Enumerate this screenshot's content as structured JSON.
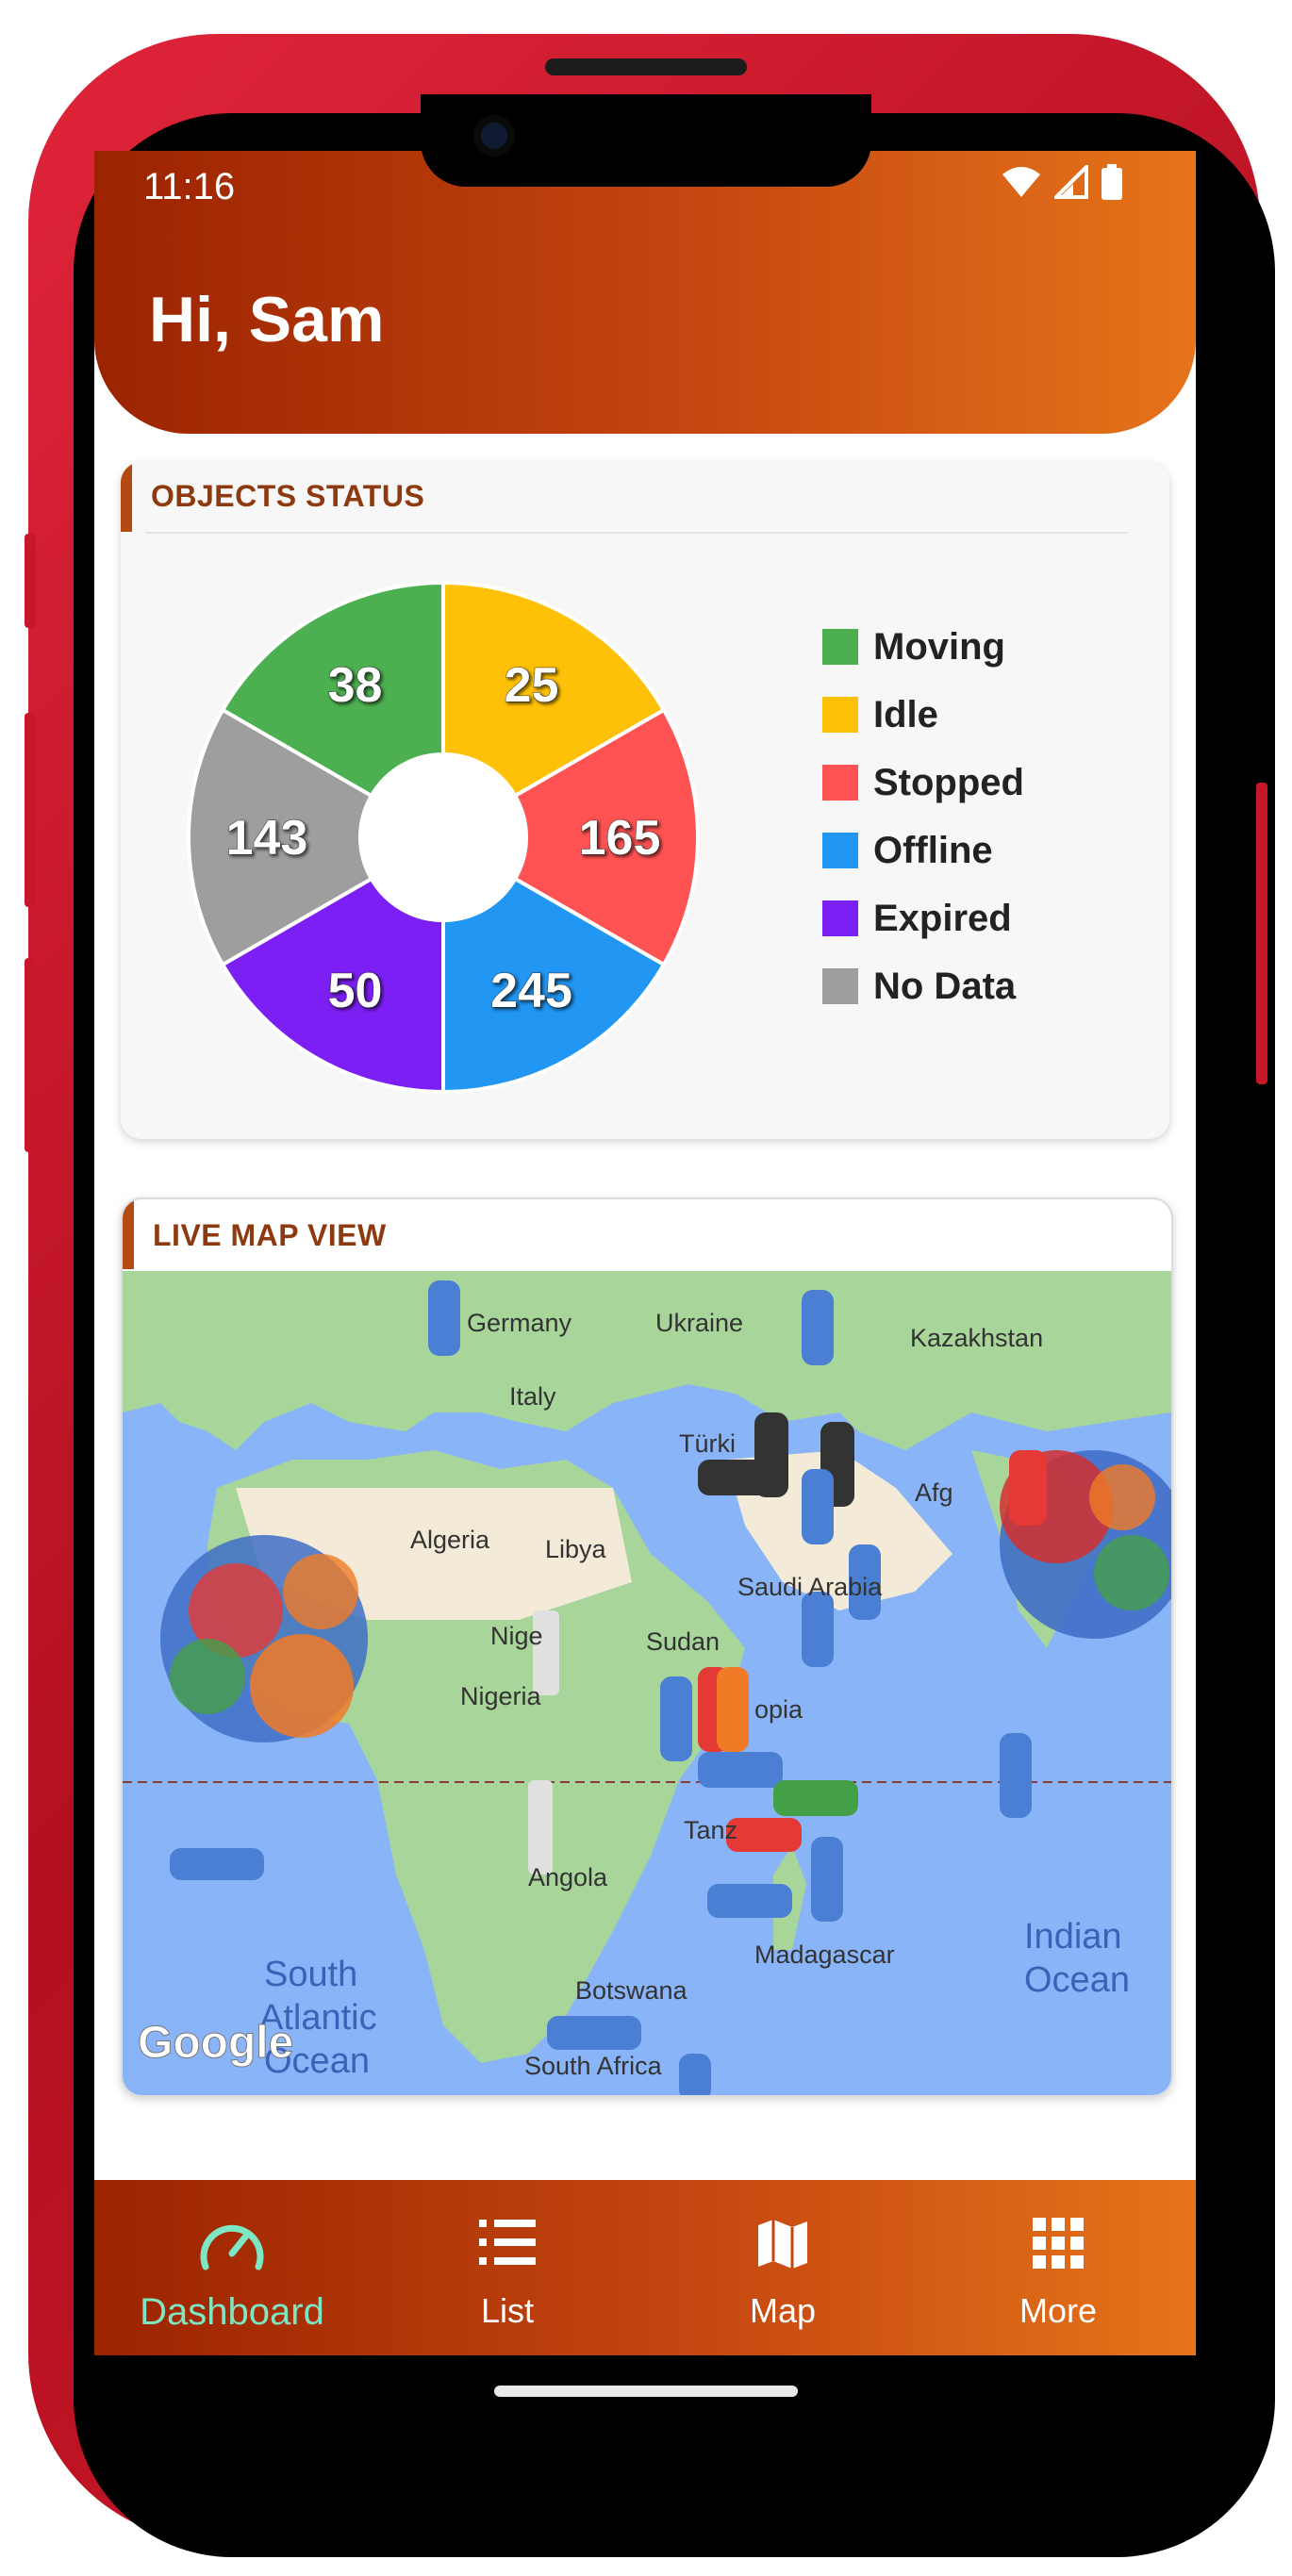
{
  "status_bar": {
    "time": "11:16",
    "icons": [
      "wifi-icon",
      "signal-icon",
      "battery-icon"
    ]
  },
  "header": {
    "greeting": "Hi, Sam"
  },
  "objects_status": {
    "title": "OBJECTS STATUS",
    "legend": [
      {
        "label": "Moving",
        "color": "#4caf50"
      },
      {
        "label": "Idle",
        "color": "#ffc107"
      },
      {
        "label": "Stopped",
        "color": "#ff5252"
      },
      {
        "label": "Offline",
        "color": "#2196f3"
      },
      {
        "label": "Expired",
        "color": "#7c1ff5"
      },
      {
        "label": "No Data",
        "color": "#9e9e9e"
      }
    ]
  },
  "chart_data": {
    "type": "pie",
    "categories": [
      "Moving",
      "Idle",
      "Stopped",
      "Offline",
      "Expired",
      "No Data"
    ],
    "values": [
      38,
      25,
      165,
      245,
      50,
      143
    ],
    "colors": [
      "#4caf50",
      "#ffc107",
      "#ff5252",
      "#2196f3",
      "#7c1ff5",
      "#9e9e9e"
    ],
    "donut": true,
    "legend": "right"
  },
  "live_map": {
    "title": "LIVE MAP VIEW",
    "labels": [
      "Germany",
      "Ukraine",
      "Kazakhstan",
      "Italy",
      "Türki",
      "Algeria",
      "Libya",
      "Saudi Arabia",
      "Nige",
      "Sudan",
      "Nigeria",
      "opia",
      "Tanz",
      "Angola",
      "Madagascar",
      "Botswana",
      "South Africa",
      "South",
      "Atlantic",
      "Ocean",
      "Indian",
      "Ocean",
      "Afg"
    ],
    "attribution": "Google"
  },
  "nav": [
    {
      "label": "Dashboard",
      "icon": "speedometer-icon",
      "active": true
    },
    {
      "label": "List",
      "icon": "list-icon",
      "active": false
    },
    {
      "label": "Map",
      "icon": "map-icon",
      "active": false
    },
    {
      "label": "More",
      "icon": "grid-icon",
      "active": false
    }
  ]
}
